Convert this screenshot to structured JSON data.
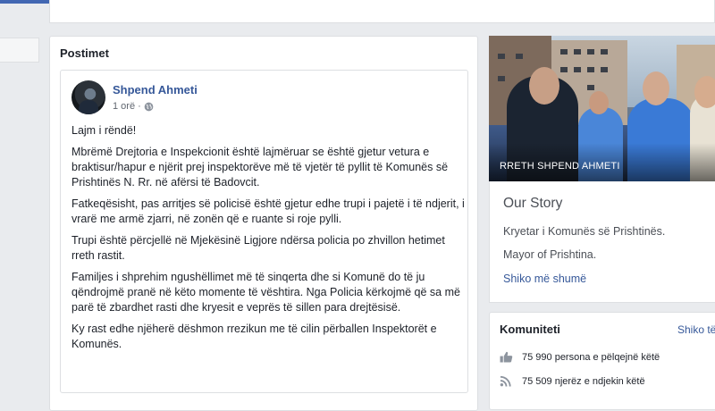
{
  "posts_section": {
    "title": "Postimet",
    "post": {
      "author": "Shpend Ahmeti",
      "time": "1 orë ·",
      "paragraphs": [
        "Lajm i rëndë!",
        "Mbrëmë Drejtoria e Inspekcionit është lajmëruar se është gjetur vetura e braktisur/hapur e njërit prej inspektorëve më të vjetër të pyllit të Komunës së Prishtinës N. Rr. në afërsi të Badovcit.",
        "Fatkeqësisht, pas arritjes së policisë është gjetur edhe trupi i pajetë i të ndjerit, i vrarë me armë zjarri, në zonën që e ruante si roje pylli.",
        "Trupi është përcjellë në Mjekësinë Ligjore ndërsa policia po zhvillon hetimet rreth rastit.",
        "Familjes i shprehim ngushëllimet më të sinqerta dhe si Komunë do të ju qëndrojmë pranë në këto momente të vështira. Nga Policia kërkojmë që sa më parë të zbardhet rasti dhe kryesit e veprës të sillen para drejtësisë.",
        "Ky rast edhe njëherë dëshmon rrezikun me të cilin përballen Inspektorët e Komunës."
      ]
    }
  },
  "sidebar": {
    "cover_caption": "RRETH SHPEND AHMETI",
    "story": {
      "title": "Our Story",
      "line1": "Kryetar i Komunës së Prishtinës.",
      "line2": "Mayor of Prishtina.",
      "more_link": "Shiko më shumë"
    },
    "community": {
      "title": "Komuniteti",
      "see_all": "Shiko të",
      "likes_text": "75 990 persona e pëlqejnë këtë",
      "follows_text": "75 509 njerëz e ndjekin këtë"
    }
  },
  "icons": {
    "privacy": "globe-icon",
    "likes": "thumbs-up-icon",
    "follows": "rss-follow-icon"
  },
  "colors": {
    "link_blue": "#365899",
    "top_bar": "#4267b2",
    "page_bg": "#e9ebee"
  }
}
